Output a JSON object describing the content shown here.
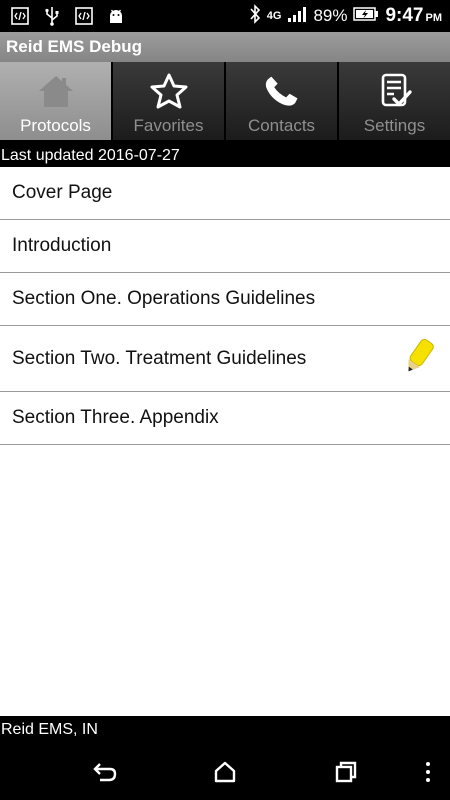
{
  "status_bar": {
    "network": "4G",
    "battery": "89%",
    "time": "9:47",
    "ampm": "PM",
    "left_icons": [
      "code-icon",
      "usb-icon",
      "code-icon",
      "android-icon"
    ]
  },
  "app": {
    "title": "Reid EMS Debug"
  },
  "tabs": [
    {
      "label": "Protocols",
      "icon": "home-icon",
      "active": true
    },
    {
      "label": "Favorites",
      "icon": "star-icon",
      "active": false
    },
    {
      "label": "Contacts",
      "icon": "phone-icon",
      "active": false
    },
    {
      "label": "Settings",
      "icon": "checklist-icon",
      "active": false
    }
  ],
  "last_updated": "Last updated 2016-07-27",
  "protocols": [
    {
      "label": "Cover Page"
    },
    {
      "label": "Introduction"
    },
    {
      "label": "Section One. Operations Guidelines"
    },
    {
      "label": "Section Two. Treatment Guidelines",
      "badge_icon": "pencil-icon"
    },
    {
      "label": "Section Three. Appendix"
    }
  ],
  "footer": "Reid EMS, IN",
  "colors": {
    "active_tab": "#a3a3a3",
    "inactive_tab": "#2a2a2a",
    "pencil": "#f5e000"
  }
}
